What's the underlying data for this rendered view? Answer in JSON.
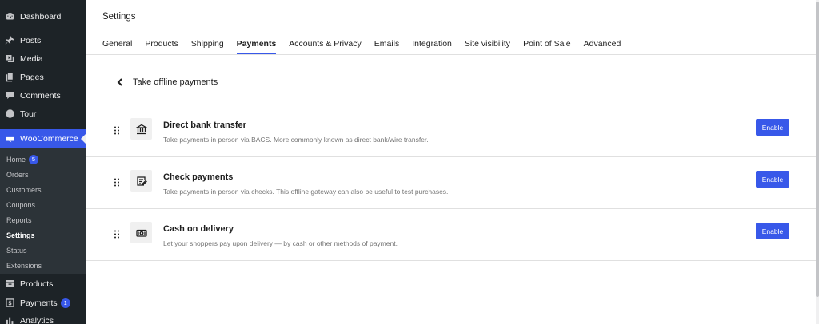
{
  "sidebar": {
    "items": [
      {
        "label": "Dashboard",
        "icon": "dashboard-icon"
      },
      {
        "label": "Posts",
        "icon": "pin-icon"
      },
      {
        "label": "Media",
        "icon": "media-icon"
      },
      {
        "label": "Pages",
        "icon": "pages-icon"
      },
      {
        "label": "Comments",
        "icon": "comment-icon"
      },
      {
        "label": "Tour",
        "icon": "globe-icon"
      }
    ],
    "woocommerce": {
      "label": "WooCommerce",
      "icon": "woo-icon"
    },
    "submenu": [
      {
        "label": "Home",
        "badge": "5"
      },
      {
        "label": "Orders"
      },
      {
        "label": "Customers"
      },
      {
        "label": "Coupons"
      },
      {
        "label": "Reports"
      },
      {
        "label": "Settings"
      },
      {
        "label": "Status"
      },
      {
        "label": "Extensions"
      }
    ],
    "bottom_items": [
      {
        "label": "Products",
        "icon": "archive-icon"
      },
      {
        "label": "Payments",
        "icon": "dollar-icon",
        "badge": "1"
      },
      {
        "label": "Analytics",
        "icon": "chart-icon"
      }
    ]
  },
  "header": {
    "title": "Settings",
    "tabs": [
      {
        "label": "General"
      },
      {
        "label": "Products"
      },
      {
        "label": "Shipping"
      },
      {
        "label": "Payments"
      },
      {
        "label": "Accounts & Privacy"
      },
      {
        "label": "Emails"
      },
      {
        "label": "Integration"
      },
      {
        "label": "Site visibility"
      },
      {
        "label": "Point of Sale"
      },
      {
        "label": "Advanced"
      }
    ],
    "active_tab": "Payments"
  },
  "section": {
    "title": "Take offline payments"
  },
  "methods": [
    {
      "title": "Direct bank transfer",
      "description": "Take payments in person via BACS. More commonly known as direct bank/wire transfer.",
      "icon": "bank-icon",
      "button": "Enable"
    },
    {
      "title": "Check payments",
      "description": "Take payments in person via checks. This offline gateway can also be useful to test purchases.",
      "icon": "check-icon",
      "button": "Enable"
    },
    {
      "title": "Cash on delivery",
      "description": "Let your shoppers pay upon delivery — by cash or other methods of payment.",
      "icon": "cash-icon",
      "button": "Enable"
    }
  ],
  "colors": {
    "accent": "#3858e9",
    "sidebar_bg": "#1d2327",
    "submenu_bg": "#2c3338"
  }
}
